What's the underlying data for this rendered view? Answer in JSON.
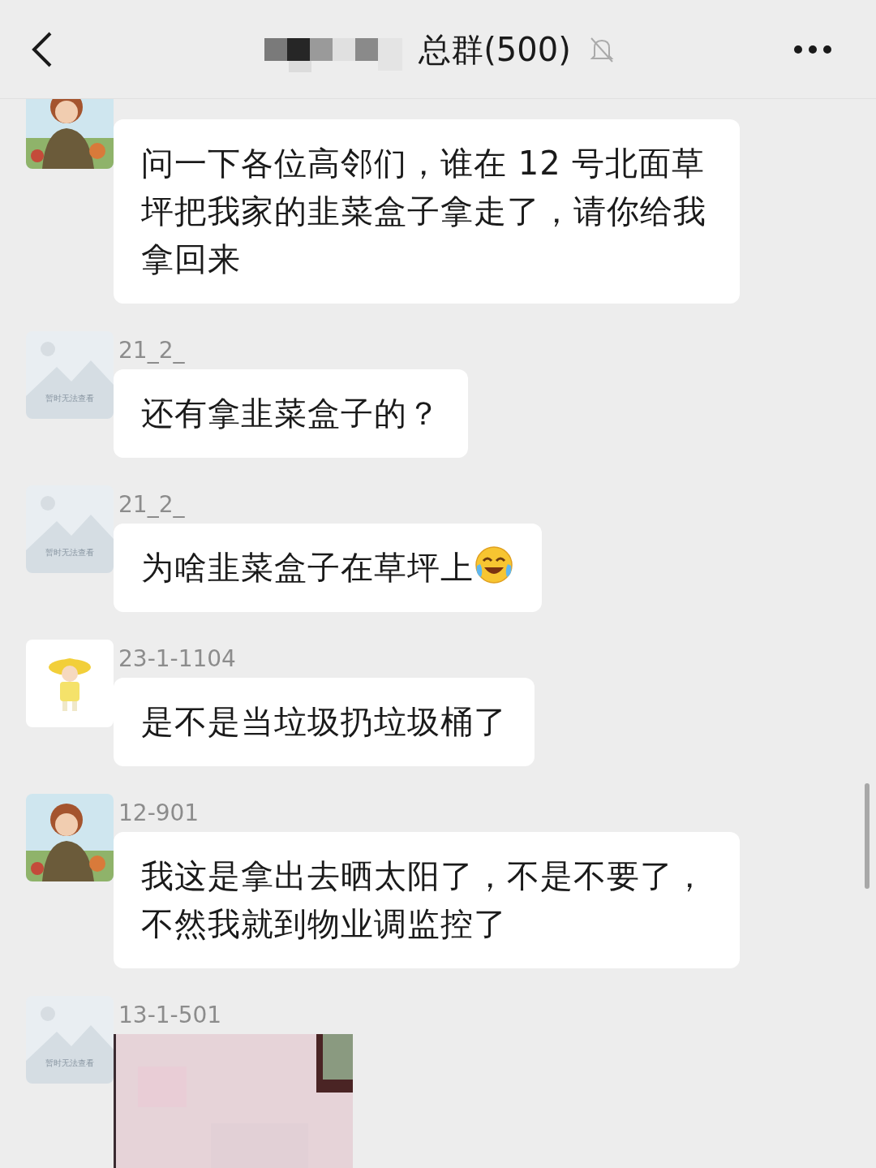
{
  "header": {
    "title": "总群(500)",
    "title_redacted": true,
    "muted": true
  },
  "messages": [
    {
      "text": "问一下各位高邻们，谁在 12 号北面草坪把我家的韭菜盒子拿走了，请你给我拿回来",
      "emoji": false
    },
    {
      "sender": "21_2_",
      "avatar": {
        "kind": "placeholder",
        "caption": "暂时无法查看"
      },
      "text": "还有拿韭菜盒子的？",
      "emoji": false
    },
    {
      "sender": "21_2_",
      "avatar": {
        "kind": "placeholder",
        "caption": "暂时无法查看"
      },
      "text": "为啥韭菜盒子在草坪上",
      "emoji": true
    },
    {
      "sender": "23-1-1104",
      "avatar": {
        "kind": "cartoon"
      },
      "text": "是不是当垃圾扔垃圾桶了",
      "emoji": false
    },
    {
      "sender": "12-901",
      "text": "我这是拿出去晒太阳了，不是不要了，不然我就到物业调监控了",
      "emoji": false
    },
    {
      "sender": "13-1-501",
      "avatar": {
        "kind": "placeholder",
        "caption": "暂时无法查看"
      }
    }
  ]
}
